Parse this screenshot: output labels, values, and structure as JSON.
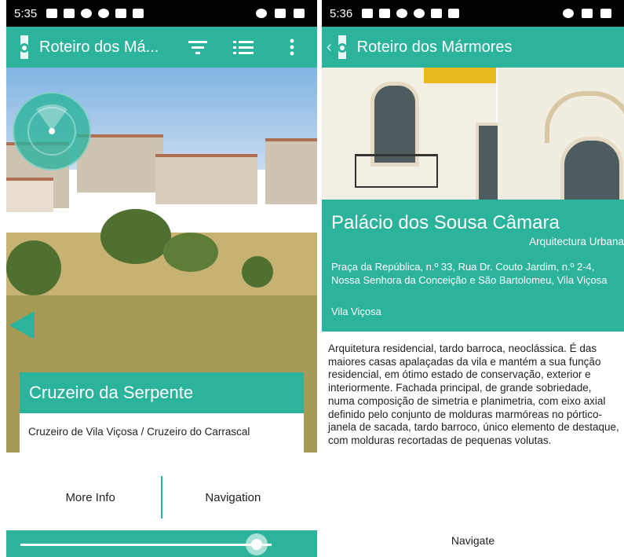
{
  "left_screen": {
    "status": {
      "time": "5:35"
    },
    "appbar": {
      "title": "Roteiro dos Má..."
    },
    "card": {
      "title": "Cruzeiro da Serpente",
      "subtitle": "Cruzeiro de Vila Viçosa / Cruzeiro do Carrascal",
      "more_info_label": "More Info",
      "navigation_label": "Navigation"
    },
    "slider": {
      "value_fraction": 0.94
    }
  },
  "right_screen": {
    "status": {
      "time": "5:36"
    },
    "appbar": {
      "title": "Roteiro dos Mármores"
    },
    "place": {
      "name": "Palácio dos Sousa Câmara",
      "category": "Arquitectura Urbana",
      "address": "Praça da República, n.º 33, Rua Dr. Couto Jardim, n.º 2-4, Nossa Senhora da Conceição e São Bartolomeu, Vila Viçosa",
      "town": "Vila Viçosa",
      "description": "Arquitetura residencial, tardo barroca, neoclássica. É das maiores casas apalaçadas da vila e mantém a sua função residencial, em ótimo estado de conservação, exterior e interiormente. Fachada principal, de grande sobriedade, numa composição de simetria e planimetria, com eixo axial definido pelo conjunto de molduras marmóreas no pórtico-janela de sacada, tardo barroco, único elemento de destaque, com molduras recortadas de pequenas volutas."
    },
    "navigate_label": "Navigate"
  },
  "colors": {
    "accent": "#2bb39b",
    "statusbar": "#000000"
  }
}
